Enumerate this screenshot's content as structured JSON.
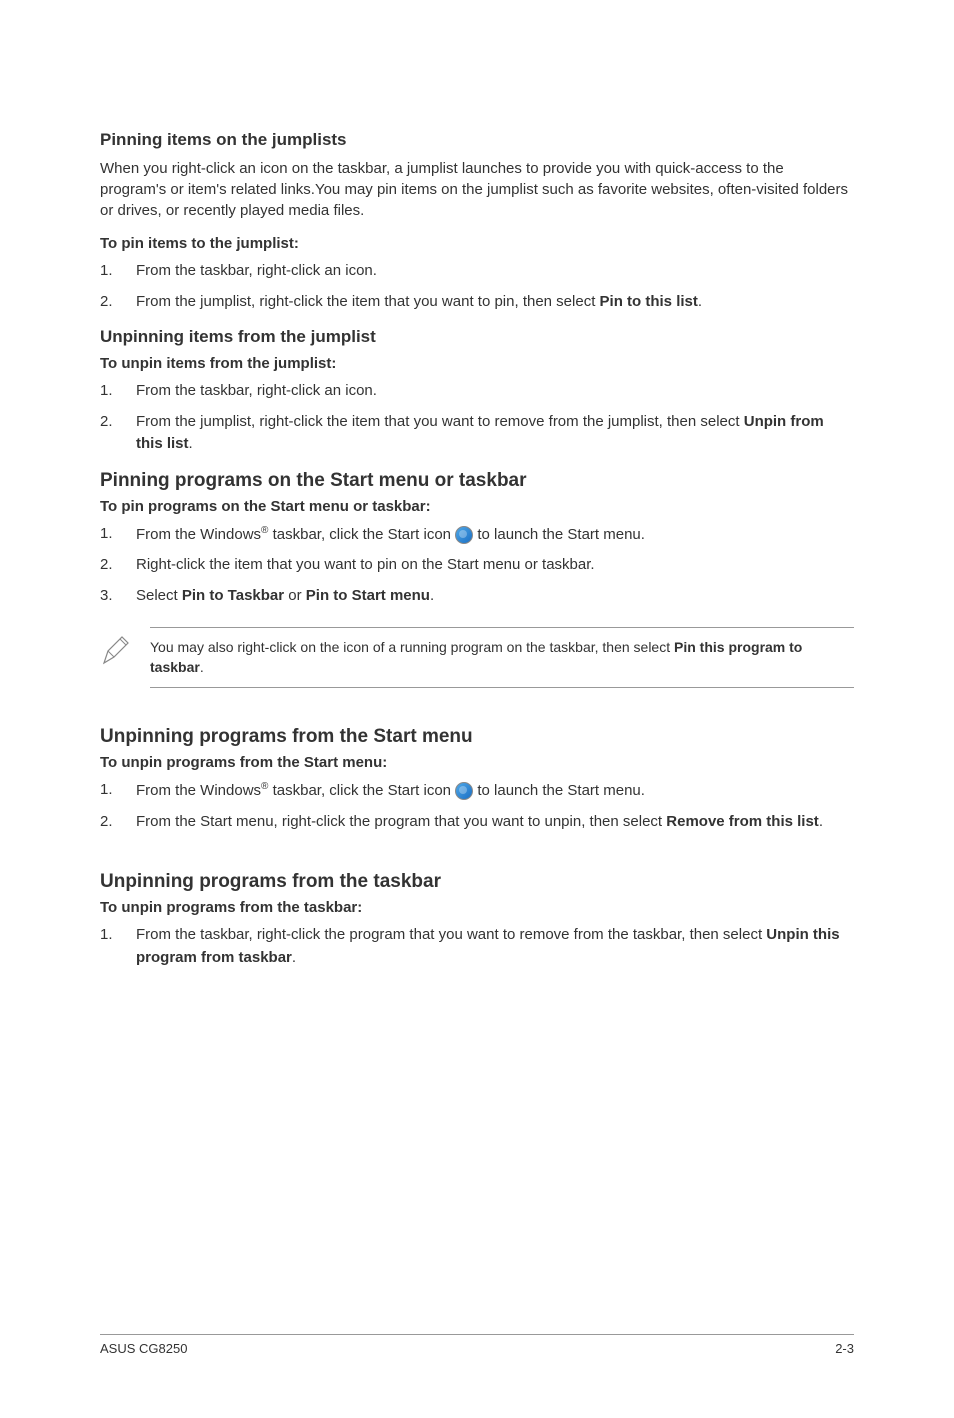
{
  "section1": {
    "title": "Pinning items on the jumplists",
    "intro": "When you right-click an icon on the taskbar, a jumplist launches to provide you with quick-access to the program's or item's related links.You may pin items on the jumplist such as favorite websites, often-visited folders or drives, or recently played media files.",
    "subtitle": "To pin items to the jumplist:",
    "step1_num": "1.",
    "step1_text": "From the taskbar, right-click an icon.",
    "step2_num": "2.",
    "step2_a": "From the jumplist, right-click the item that you want to pin, then select ",
    "step2_b": "Pin to this list",
    "step2_c": "."
  },
  "section2": {
    "title": "Unpinning items from the jumplist",
    "subtitle": "To unpin items from the jumplist:",
    "step1_num": "1.",
    "step1_text": "From the taskbar, right-click an icon.",
    "step2_num": "2.",
    "step2_a": "From the jumplist, right-click the item that you want to remove from the jumplist, then select ",
    "step2_b": "Unpin from this list",
    "step2_c": "."
  },
  "section3": {
    "title": "Pinning programs on the Start menu or taskbar",
    "subtitle": "To pin programs on the Start menu or taskbar:",
    "step1_num": "1.",
    "step1_a": "From the Windows",
    "step1_sup": "®",
    "step1_b": " taskbar, click the Start icon ",
    "step1_c": " to launch the Start menu.",
    "step2_num": "2.",
    "step2_text": "Right-click the item that you want to pin on the Start menu or taskbar.",
    "step3_num": "3.",
    "step3_a": "Select ",
    "step3_b": "Pin to Taskbar",
    "step3_c": " or ",
    "step3_d": "Pin to Start menu",
    "step3_e": ".",
    "note_a": "You may also right-click on the icon of a running program on the taskbar, then select ",
    "note_b": "Pin this program to taskbar",
    "note_c": "."
  },
  "section4": {
    "title": "Unpinning programs from the Start menu",
    "subtitle": "To unpin programs from the Start menu:",
    "step1_num": "1.",
    "step1_a": "From the Windows",
    "step1_sup": "®",
    "step1_b": " taskbar, click the Start icon ",
    "step1_c": " to launch the Start menu.",
    "step2_num": "2.",
    "step2_a": "From the Start menu, right-click the program that you want to unpin, then select ",
    "step2_b": "Remove from this list",
    "step2_c": "."
  },
  "section5": {
    "title": "Unpinning programs from the taskbar",
    "subtitle": "To unpin programs from the taskbar:",
    "step1_num": "1.",
    "step1_a": "From the taskbar, right-click the program that you want to remove from the taskbar, then select ",
    "step1_b": "Unpin this program from taskbar",
    "step1_c": "."
  },
  "footer": {
    "left": "ASUS CG8250",
    "right": "2-3"
  }
}
